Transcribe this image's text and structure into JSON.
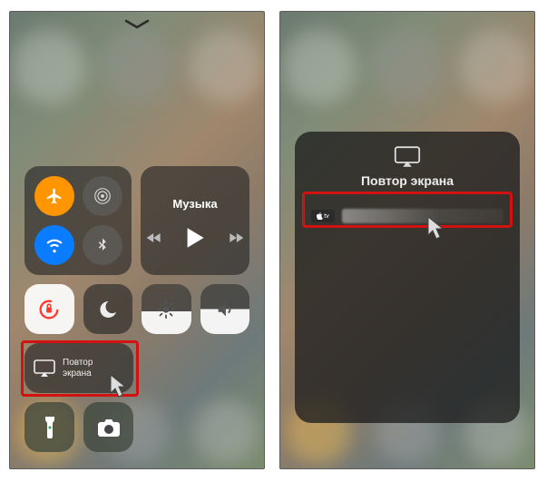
{
  "left": {
    "music_label": "Музыка",
    "mirror_label": "Повтор\nэкрана"
  },
  "right": {
    "panel_title": "Повтор экрана",
    "device_badge": "tv"
  },
  "icons": {
    "chevron": "chevron-down-icon",
    "airplane": "airplane-icon",
    "airdrop": "airdrop-icon",
    "wifi": "wifi-icon",
    "bluetooth": "bluetooth-icon",
    "lock": "rotation-lock-icon",
    "dnd": "do-not-disturb-icon",
    "mirror": "screen-mirroring-icon",
    "brightness": "brightness-icon",
    "volume": "volume-icon",
    "flashlight": "flashlight-icon",
    "camera": "camera-icon",
    "prev": "previous-track-icon",
    "play": "play-icon",
    "next": "next-track-icon"
  }
}
